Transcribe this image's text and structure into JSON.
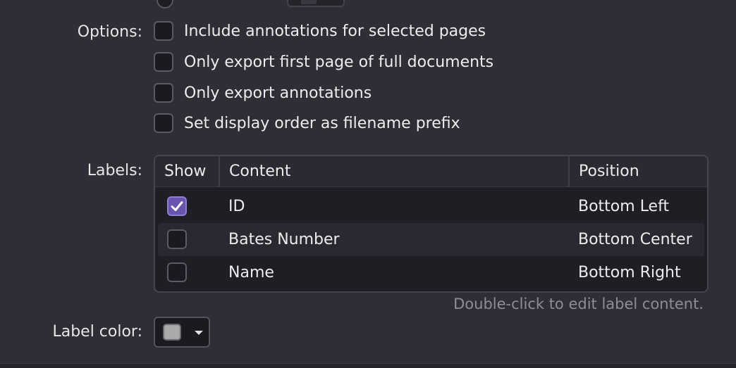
{
  "options": {
    "label": "Options:",
    "items": [
      {
        "label": "Include annotations for selected pages",
        "checked": false
      },
      {
        "label": "Only export first page of full documents",
        "checked": false
      },
      {
        "label": "Only export annotations",
        "checked": false
      },
      {
        "label": "Set display order as filename prefix",
        "checked": false
      }
    ]
  },
  "labels": {
    "label": "Labels:",
    "columns": {
      "show": "Show",
      "content": "Content",
      "position": "Position"
    },
    "rows": [
      {
        "show": true,
        "content": "ID",
        "position": "Bottom Left"
      },
      {
        "show": false,
        "content": "Bates Number",
        "position": "Bottom Center"
      },
      {
        "show": false,
        "content": "Name",
        "position": "Bottom Right"
      }
    ],
    "hint": "Double-click to edit label content."
  },
  "label_color": {
    "label": "Label color:",
    "value": "#a9a9a9"
  },
  "colors": {
    "background": "#2f2e37",
    "accent": "#6a54b0"
  }
}
